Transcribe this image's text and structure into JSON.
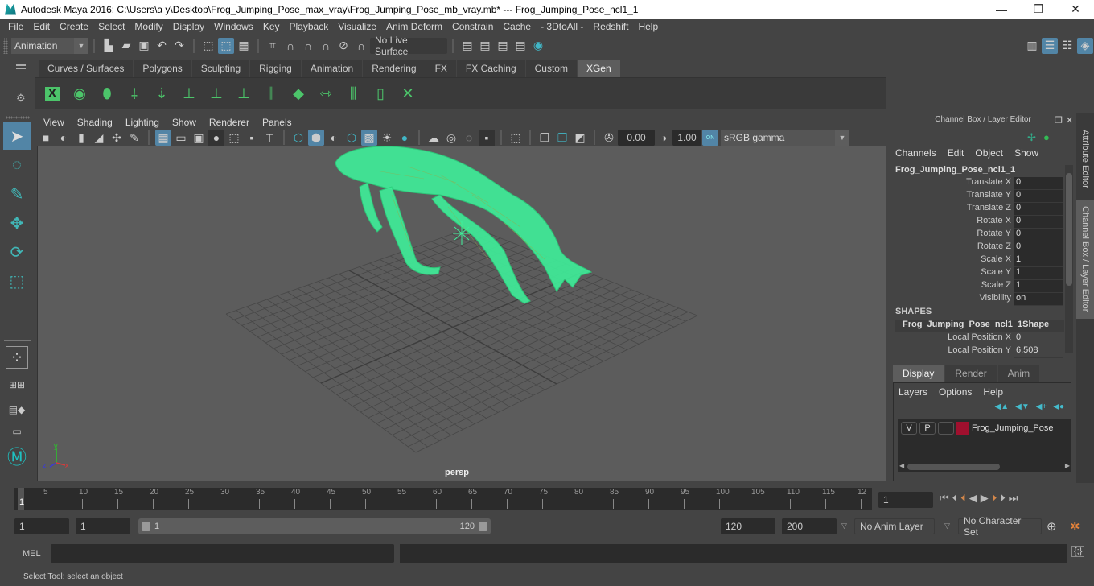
{
  "window": {
    "title": "Autodesk Maya 2016: C:\\Users\\a y\\Desktop\\Frog_Jumping_Pose_max_vray\\Frog_Jumping_Pose_mb_vray.mb*   ---   Frog_Jumping_Pose_ncl1_1",
    "minimize": "—",
    "restore": "❐",
    "close": "✕"
  },
  "menubar": [
    "File",
    "Edit",
    "Create",
    "Select",
    "Modify",
    "Display",
    "Windows",
    "Key",
    "Playback",
    "Visualize",
    "Anim Deform",
    "Constrain",
    "Cache",
    "- 3DtoAll -",
    "Redshift",
    "Help"
  ],
  "statusline": {
    "mode": "Animation",
    "live_surface": "No Live Surface"
  },
  "shelf": {
    "tabs": [
      "Curves / Surfaces",
      "Polygons",
      "Sculpting",
      "Rigging",
      "Animation",
      "Rendering",
      "FX",
      "FX Caching",
      "Custom",
      "XGen"
    ],
    "active_tab": "XGen",
    "icons": [
      "xgen-editor-icon",
      "preview-icon",
      "clear-preview-icon",
      "add-guides-icon",
      "place-guides-icon",
      "add-guide-icon",
      "sculpt-guide-icon",
      "lock-guide-icon",
      "guide-splines-icon",
      "density-icon",
      "rebuild-guides-icon",
      "select-guides-icon",
      "guides-box-icon",
      "delete-guides-icon"
    ]
  },
  "viewport": {
    "menu": [
      "View",
      "Shading",
      "Lighting",
      "Show",
      "Renderer",
      "Panels"
    ],
    "exposure": "0.00",
    "gamma": "1.00",
    "color_space": "sRGB gamma",
    "color_mgmt": "ON",
    "camera": "persp",
    "axes": {
      "x": "x",
      "y": "y",
      "z": "z"
    },
    "wire_color": "#3fef9a"
  },
  "channelbox": {
    "title": "Channel Box / Layer Editor",
    "menu": [
      "Channels",
      "Edit",
      "Object",
      "Show"
    ],
    "object": "Frog_Jumping_Pose_ncl1_1",
    "attributes": [
      {
        "label": "Translate X",
        "value": "0"
      },
      {
        "label": "Translate Y",
        "value": "0"
      },
      {
        "label": "Translate Z",
        "value": "0"
      },
      {
        "label": "Rotate X",
        "value": "0"
      },
      {
        "label": "Rotate Y",
        "value": "0"
      },
      {
        "label": "Rotate Z",
        "value": "0"
      },
      {
        "label": "Scale X",
        "value": "1"
      },
      {
        "label": "Scale Y",
        "value": "1"
      },
      {
        "label": "Scale Z",
        "value": "1"
      },
      {
        "label": "Visibility",
        "value": "on"
      }
    ],
    "shapes_header": "SHAPES",
    "shape_name": "Frog_Jumping_Pose_ncl1_1Shape",
    "shape_attributes": [
      {
        "label": "Local Position X",
        "value": "0"
      },
      {
        "label": "Local Position Y",
        "value": "6.508"
      }
    ]
  },
  "sidetabs": {
    "attribute_editor": "Attribute Editor",
    "channel_box": "Channel Box / Layer Editor"
  },
  "layers": {
    "tabs": [
      "Display",
      "Render",
      "Anim"
    ],
    "active_tab": "Display",
    "menu": [
      "Layers",
      "Options",
      "Help"
    ],
    "items": [
      {
        "v": "V",
        "p": "P",
        "color": "#a0102e",
        "name": "Frog_Jumping_Pose"
      }
    ]
  },
  "timeline": {
    "ticks": [
      "5",
      "10",
      "15",
      "20",
      "25",
      "30",
      "35",
      "40",
      "45",
      "50",
      "55",
      "60",
      "65",
      "70",
      "75",
      "80",
      "85",
      "90",
      "95",
      "100",
      "105",
      "110",
      "115",
      "12"
    ],
    "current": "1",
    "current_field": "1"
  },
  "range": {
    "start": "1",
    "playback_start": "1",
    "slider_start": "1",
    "slider_end": "120",
    "playback_end": "120",
    "end": "200",
    "anim_layer": "No Anim Layer",
    "character_set": "No Character Set"
  },
  "cmd": {
    "lang": "MEL",
    "help": "Select Tool: select an object"
  }
}
